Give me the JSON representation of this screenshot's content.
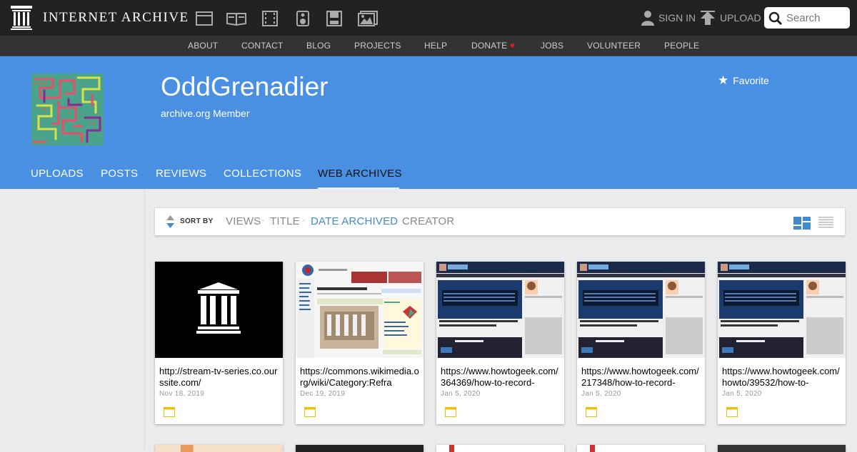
{
  "topbar": {
    "brand": "INTERNET ARCHIVE",
    "media_icons": [
      "web-icon",
      "texts-icon",
      "video-icon",
      "audio-icon",
      "software-icon",
      "images-icon"
    ],
    "sign_in": "SIGN IN",
    "upload": "UPLOAD",
    "search_placeholder": "Search"
  },
  "subnav": {
    "items": [
      "ABOUT",
      "CONTACT",
      "BLOG",
      "PROJECTS",
      "HELP",
      "DONATE",
      "JOBS",
      "VOLUNTEER",
      "PEOPLE"
    ],
    "donate_heart": "♥"
  },
  "profile": {
    "name": "OddGrenadier",
    "subtitle": "archive.org Member",
    "favorite": "Favorite",
    "star": "★",
    "tabs": [
      "UPLOADS",
      "POSTS",
      "REVIEWS",
      "COLLECTIONS",
      "WEB ARCHIVES"
    ],
    "active_tab": "WEB ARCHIVES"
  },
  "sort": {
    "label": "SORT BY",
    "options": [
      "VIEWS",
      "TITLE",
      "DATE ARCHIVED",
      "CREATOR"
    ],
    "active": "DATE ARCHIVED",
    "separator": "·"
  },
  "colors": {
    "header_blue": "#4a90e2",
    "link_blue": "#428bca",
    "collection_icon_yellow": "#f0c000"
  },
  "items": [
    {
      "title": "http://stream-tv-series.co.ourssite.com/",
      "date": "Nov 18, 2019",
      "thumb": "archive-logo"
    },
    {
      "title": "https://commons.wikimedia.org/wiki/Category:Refra",
      "date": "Dec 19, 2019",
      "thumb": "wikimedia"
    },
    {
      "title": "https://www.howtogeek.com/364369/how-to-record-",
      "date": "Jan 5, 2020",
      "thumb": "howtogeek"
    },
    {
      "title": "https://www.howtogeek.com/217348/how-to-record-",
      "date": "Jan 5, 2020",
      "thumb": "howtogeek"
    },
    {
      "title": "https://www.howtogeek.com/howto/39532/how-to-",
      "date": "Jan 5, 2020",
      "thumb": "howtogeek"
    }
  ]
}
